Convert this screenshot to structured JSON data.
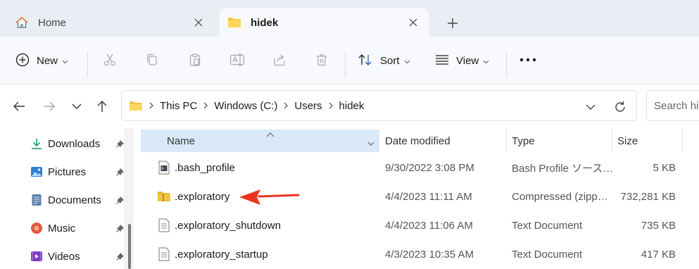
{
  "tabs": [
    {
      "label": "Home",
      "icon": "home-icon"
    },
    {
      "label": "hidek",
      "icon": "folder-icon",
      "active": true
    }
  ],
  "toolbar": {
    "new_label": "New",
    "sort_label": "Sort",
    "view_label": "View",
    "icons": [
      "cut-icon",
      "copy-icon",
      "paste-icon",
      "rename-icon",
      "share-icon",
      "delete-icon",
      "more-icon"
    ]
  },
  "address": {
    "crumbs": [
      "This PC",
      "Windows (C:)",
      "Users",
      "hidek"
    ]
  },
  "search": {
    "placeholder": "Search hidek"
  },
  "sidebar": {
    "items": [
      {
        "label": "Downloads",
        "icon": "download-icon"
      },
      {
        "label": "Pictures",
        "icon": "pictures-icon"
      },
      {
        "label": "Documents",
        "icon": "documents-icon"
      },
      {
        "label": "Music",
        "icon": "music-icon"
      },
      {
        "label": "Videos",
        "icon": "videos-icon"
      }
    ]
  },
  "columns": {
    "name": "Name",
    "date": "Date modified",
    "type": "Type",
    "size": "Size"
  },
  "files": [
    {
      "name": ".bash_profile",
      "date": "9/30/2022 3:08 PM",
      "type": "Bash Profile ソース…",
      "size": "5 KB",
      "icon": "script-file-icon"
    },
    {
      "name": ".exploratory",
      "date": "4/4/2023 11:11 AM",
      "type": "Compressed (zipp…",
      "size": "732,281 KB",
      "icon": "zip-folder-icon"
    },
    {
      "name": ".exploratory_shutdown",
      "date": "4/4/2023 11:06 AM",
      "type": "Text Document",
      "size": "735 KB",
      "icon": "text-file-icon"
    },
    {
      "name": ".exploratory_startup",
      "date": "4/3/2023 10:35 AM",
      "type": "Text Document",
      "size": "417 KB",
      "icon": "text-file-icon"
    }
  ],
  "colors": {
    "accent": "#0067c0",
    "selected_header": "#d9e9f8",
    "annotation": "#e8341c",
    "folder": "#f5c542"
  }
}
